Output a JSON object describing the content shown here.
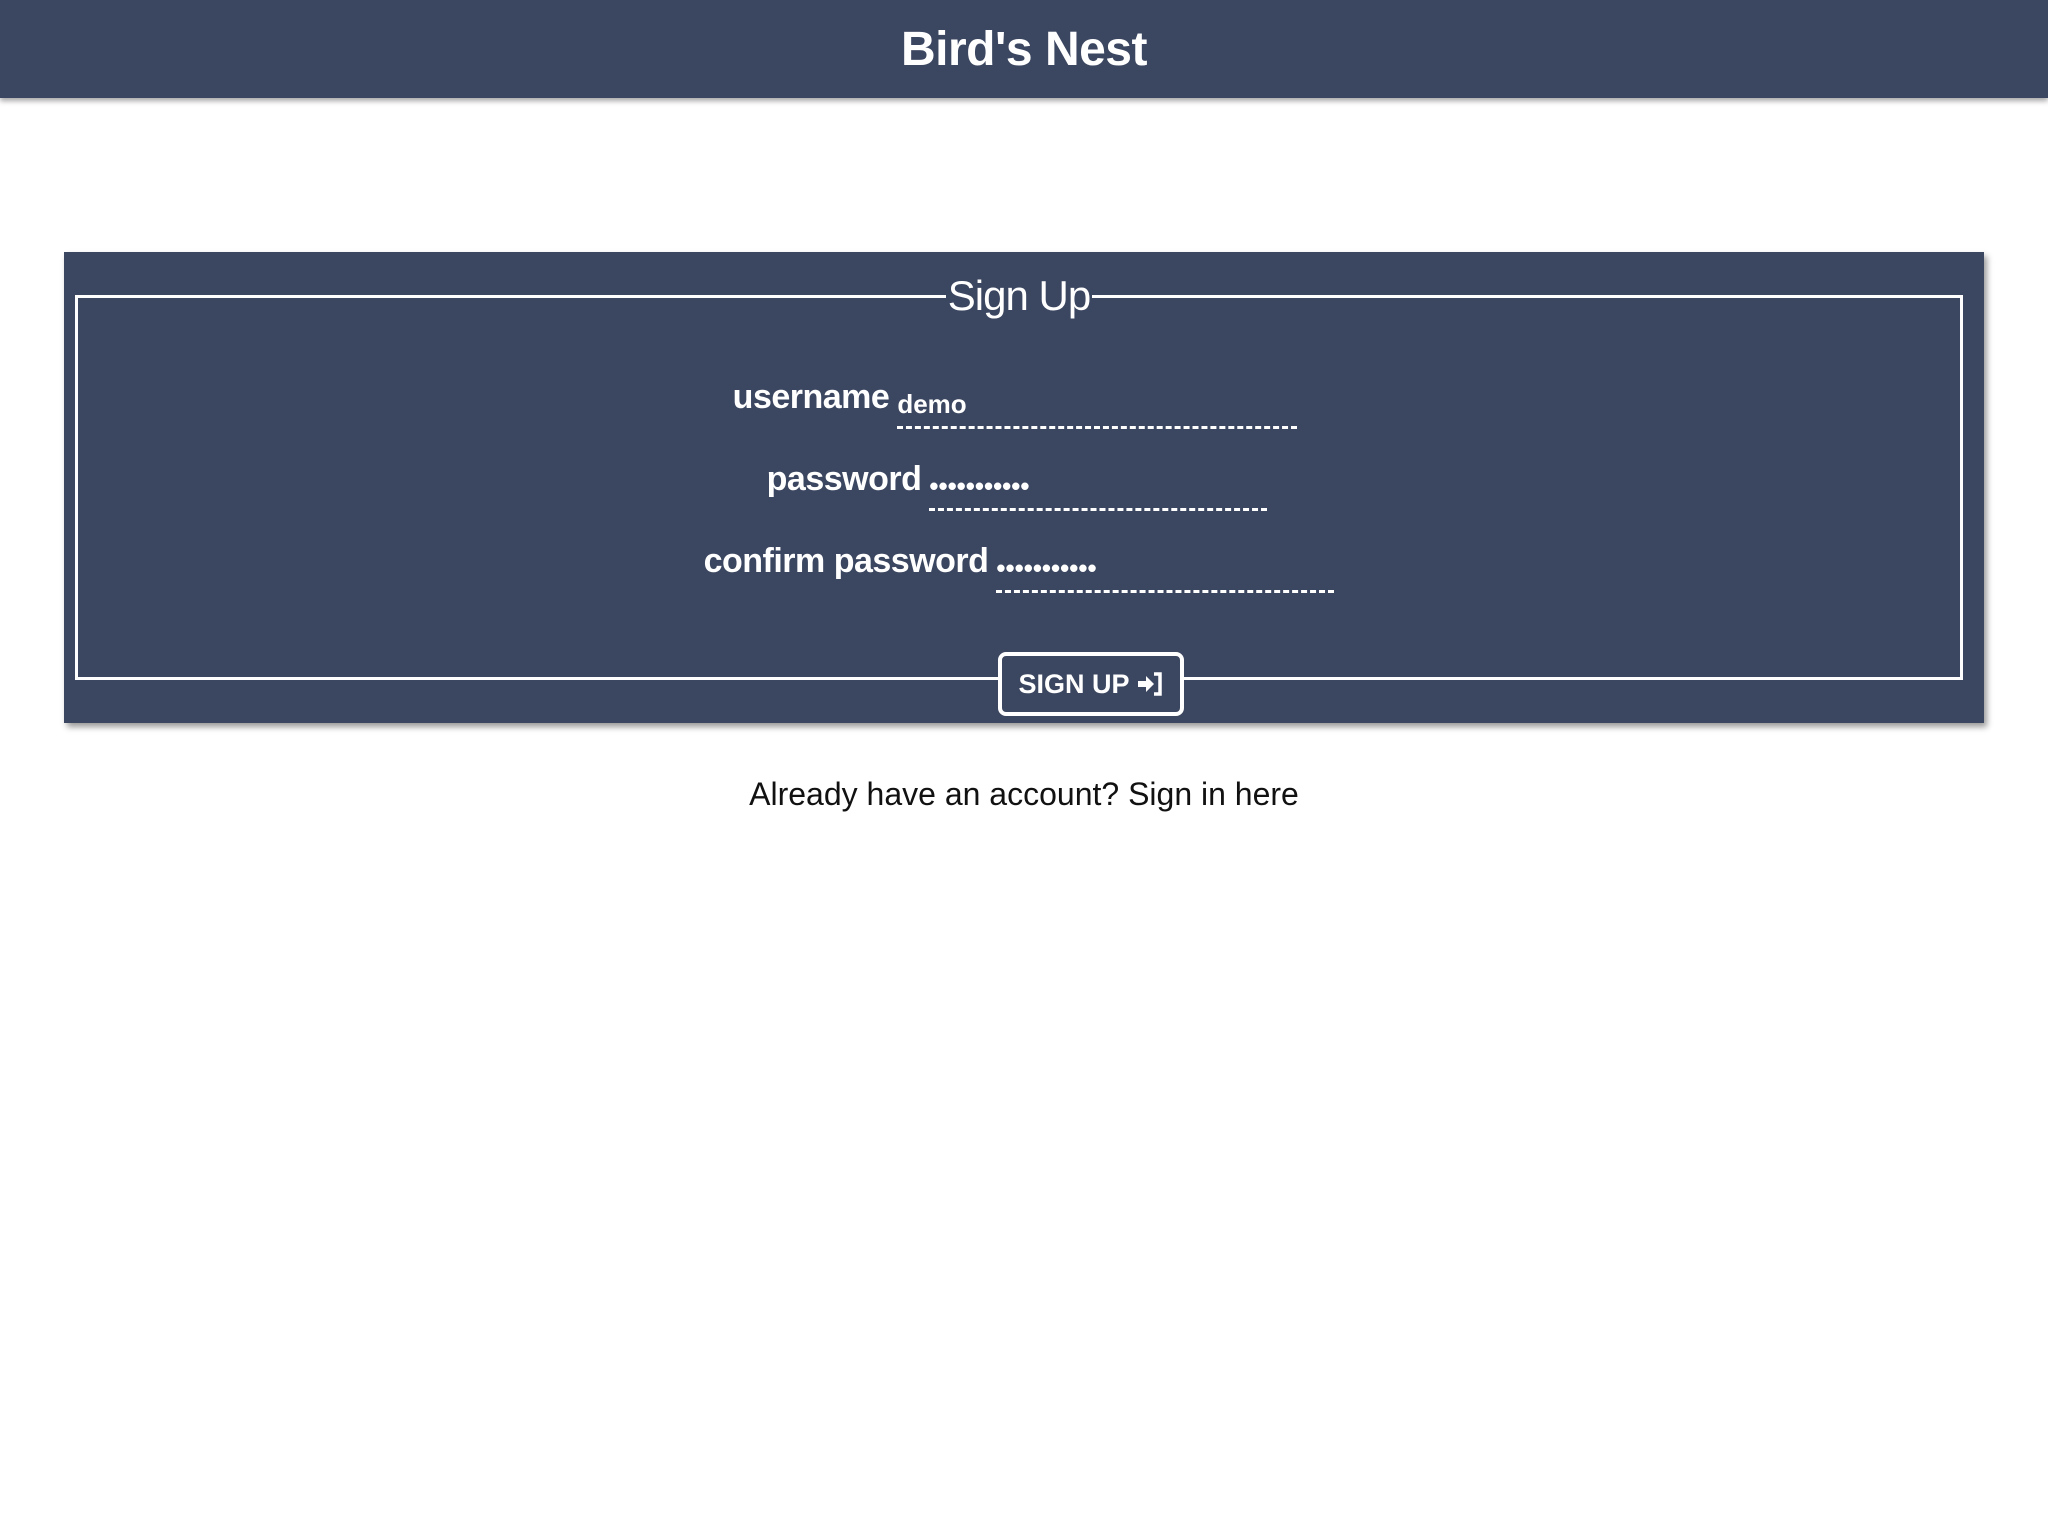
{
  "header": {
    "title": "Bird's Nest"
  },
  "form": {
    "legend": "Sign Up",
    "username": {
      "label": "username",
      "value": "demo"
    },
    "password": {
      "label": "password",
      "value": "•••••••••••"
    },
    "confirm_password": {
      "label": "confirm password",
      "value": "•••••••••••"
    },
    "submit_label": "SIGN UP",
    "submit_icon": "sign-in-icon"
  },
  "footer": {
    "prompt": "Already have an account?",
    "link": "Sign in here"
  },
  "colors": {
    "primary": "#3b4660",
    "text": "#ffffff"
  }
}
